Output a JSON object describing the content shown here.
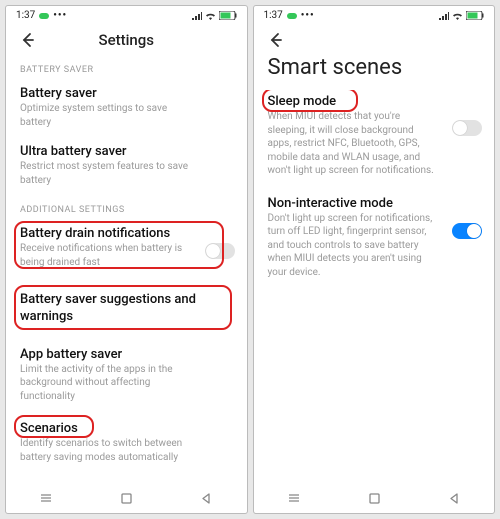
{
  "status": {
    "time": "1:37",
    "dots": "•••"
  },
  "left": {
    "title": "Settings",
    "section1": "BATTERY SAVER",
    "batterySaver": {
      "title": "Battery saver",
      "sub": "Optimize system settings to save battery"
    },
    "ultra": {
      "title": "Ultra battery saver",
      "sub": "Restrict most system features to save battery"
    },
    "section2": "ADDITIONAL SETTINGS",
    "drain": {
      "title": "Battery drain notifications",
      "sub": "Receive notifications when battery is being drained fast"
    },
    "suggest": {
      "title": "Battery saver suggestions and warnings"
    },
    "appSaver": {
      "title": "App battery saver",
      "sub": "Limit the activity of the apps in the background without affecting functionality"
    },
    "scenarios": {
      "title": "Scenarios",
      "sub": "Identify scenarios to switch between battery saving modes automatically"
    }
  },
  "right": {
    "heading": "Smart scenes",
    "sleep": {
      "title": "Sleep mode",
      "sub": "When MIUI detects that you're sleeping, it will close background apps, restrict NFC, Bluetooth, GPS, mobile data and WLAN usage, and won't light up screen for notifications."
    },
    "nonint": {
      "title": "Non-interactive mode",
      "sub": "Don't light up screen for notifications, turn off LED light, fingerprint sensor, and touch controls to save battery when MIUI detects you aren't using your device."
    }
  },
  "nav": {
    "menu": "≡",
    "home": "◻",
    "back": "◁"
  }
}
